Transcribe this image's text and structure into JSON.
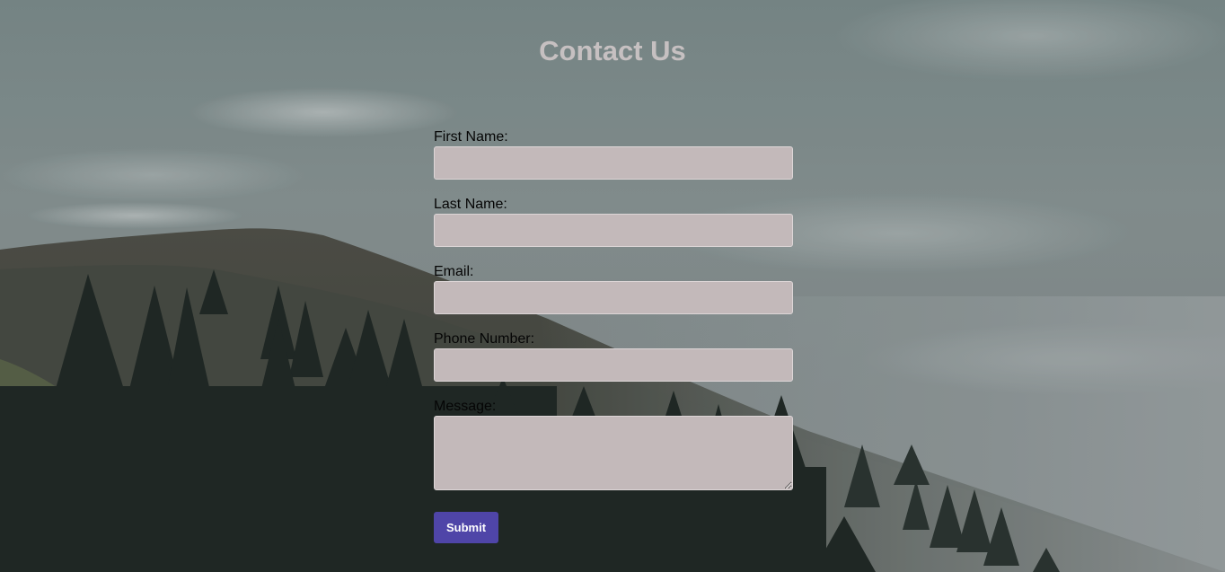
{
  "page": {
    "title": "Contact Us"
  },
  "form": {
    "fields": [
      {
        "label": "First Name:",
        "value": "",
        "placeholder": ""
      },
      {
        "label": "Last Name:",
        "value": "",
        "placeholder": ""
      },
      {
        "label": "Email:",
        "value": "",
        "placeholder": ""
      },
      {
        "label": "Phone Number:",
        "value": "",
        "placeholder": ""
      }
    ],
    "message": {
      "label": "Message:",
      "value": "",
      "placeholder": ""
    },
    "submit_label": "Submit"
  },
  "colors": {
    "title": "#c6c0c1",
    "input_background": "#c3b9ba",
    "button": "#4f45a8",
    "sky": "#8f9c9d",
    "hills": "#4a4f47",
    "trees": "#1f2724"
  }
}
